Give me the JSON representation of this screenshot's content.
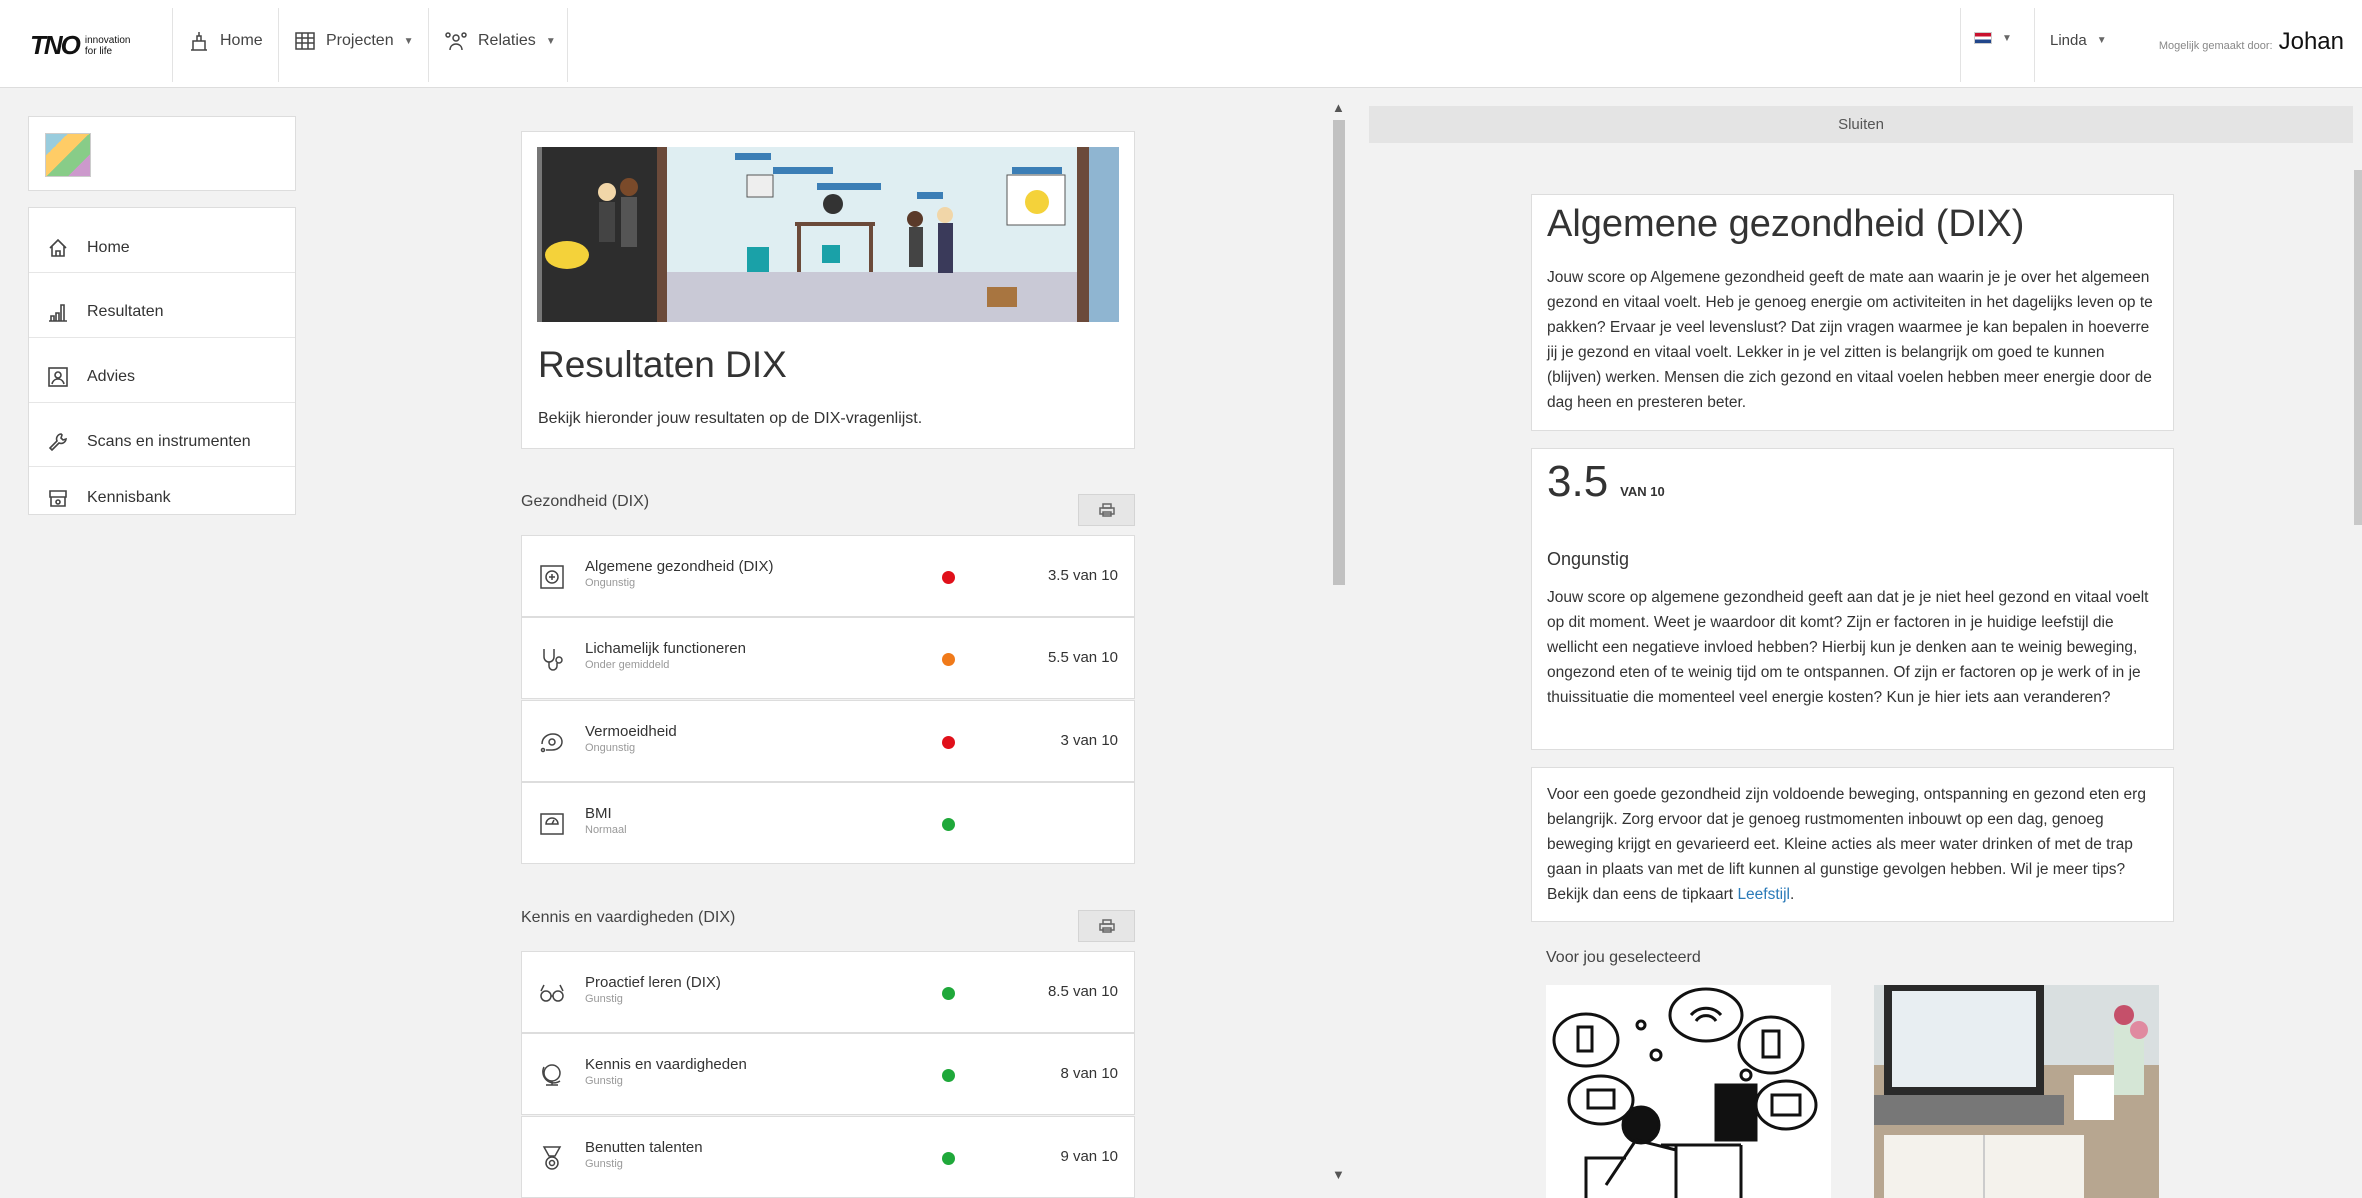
{
  "topbar": {
    "logo_mark": "TNO",
    "logo_tagline": "innovation for life",
    "nav": [
      {
        "label": "Home",
        "icon": "home-building-icon"
      },
      {
        "label": "Projecten",
        "icon": "projects-icon"
      },
      {
        "label": "Relaties",
        "icon": "people-icon"
      }
    ],
    "language_flag": "nl-flag-icon",
    "user_label": "Linda",
    "made_by_label": "Mogelijk gemaakt door:",
    "made_by_name": "Johan"
  },
  "sidebar": {
    "items": [
      {
        "label": "Home",
        "icon": "home-icon"
      },
      {
        "label": "Resultaten",
        "icon": "chart-icon"
      },
      {
        "label": "Advies",
        "icon": "advice-icon"
      },
      {
        "label": "Scans en instrumenten",
        "icon": "wrench-icon"
      },
      {
        "label": "Kennisbank",
        "icon": "knowledge-icon"
      }
    ]
  },
  "main": {
    "title": "Resultaten DIX",
    "intro": "Bekijk hieronder jouw resultaten op de DIX-vragenlijst.",
    "sections": [
      {
        "title": "Gezondheid (DIX)",
        "rows": [
          {
            "name": "Algemene gezondheid (DIX)",
            "status": "Ongunstig",
            "score": "3.5 van 10",
            "color": "#e0101a",
            "icon": "health-icon"
          },
          {
            "name": "Lichamelijk functioneren",
            "status": "Onder gemiddeld",
            "score": "5.5 van 10",
            "color": "#f07a1a",
            "icon": "stethoscope-icon"
          },
          {
            "name": "Vermoeidheid",
            "status": "Ongunstig",
            "score": "3 van 10",
            "color": "#e0101a",
            "icon": "fatigue-icon"
          },
          {
            "name": "BMI",
            "status": "Normaal",
            "score": "",
            "color": "#1fa83a",
            "icon": "scale-icon"
          }
        ]
      },
      {
        "title": "Kennis en vaardigheden (DIX)",
        "rows": [
          {
            "name": "Proactief leren (DIX)",
            "status": "Gunstig",
            "score": "8.5 van 10",
            "color": "#1fa83a",
            "icon": "glasses-icon"
          },
          {
            "name": "Kennis en vaardigheden",
            "status": "Gunstig",
            "score": "8 van 10",
            "color": "#1fa83a",
            "icon": "globe-icon"
          },
          {
            "name": "Benutten talenten",
            "status": "Gunstig",
            "score": "9 van 10",
            "color": "#1fa83a",
            "icon": "medal-icon"
          }
        ]
      }
    ]
  },
  "detail": {
    "close_label": "Sluiten",
    "title": "Algemene gezondheid (DIX)",
    "description": "Jouw score op Algemene gezondheid geeft de mate aan waarin je je over het algemeen gezond en vitaal voelt. Heb je genoeg energie om activiteiten in het dagelijks leven op te pakken? Ervaar je veel levenslust? Dat zijn vragen waarmee je kan bepalen in hoeverre jij je gezond en vitaal voelt. Lekker in je vel zitten is belangrijk om goed te kunnen (blijven) werken. Mensen die zich gezond en vitaal voelen hebben meer energie door de dag heen en presteren beter.",
    "score": "3.5",
    "score_suffix": "VAN 10",
    "verdict": "Ongunstig",
    "verdict_text": "Jouw score op algemene gezondheid geeft aan dat je je niet heel gezond en vitaal voelt op dit moment. Weet je waardoor dit komt? Zijn er factoren in je huidige leefstijl die wellicht een negatieve invloed hebben? Hierbij kun je denken aan te weinig beweging, ongezond eten of te weinig tijd om te ontspannen. Of zijn er factoren op je werk of in je thuissituatie die momenteel veel energie kosten? Kun je hier iets aan veranderen?",
    "advice_text": "Voor een goede gezondheid zijn voldoende beweging, ontspanning en gezond eten erg belangrijk. Zorg ervoor dat je genoeg rustmomenten inbouwt op een dag, genoeg beweging krijgt en gevarieerd eet. Kleine acties als meer water drinken of met de trap gaan in plaats van met de lift kunnen al gunstige gevolgen hebben. Wil je meer tips? Bekijk dan eens de tipkaart",
    "advice_link": "Leefstijl",
    "advice_end": ".",
    "selected_title": "Voor jou geselecteerd"
  }
}
